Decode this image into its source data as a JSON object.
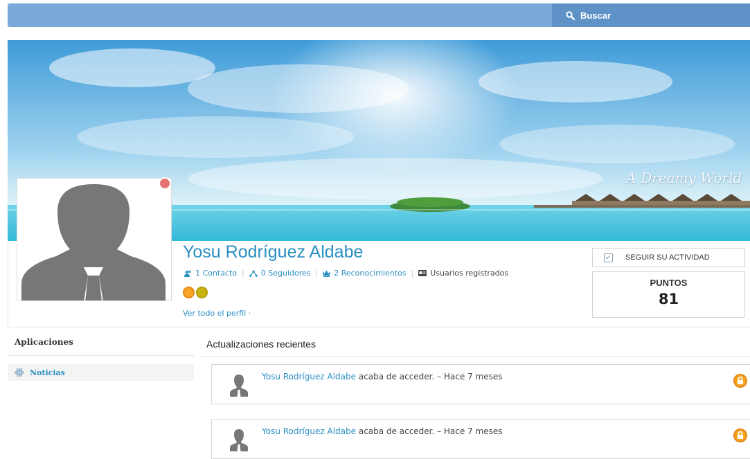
{
  "search": {
    "label": "Buscar"
  },
  "cover": {
    "caption": "A Dreamy World"
  },
  "profile": {
    "name": "Yosu Rodríguez Aldabe",
    "contacts": "1 Contacto",
    "followers": "0 Seguidores",
    "awards": "2 Reconocimientos",
    "group": "Usuarios registrados",
    "view_all": "Ver todo el perfil ·"
  },
  "actions": {
    "follow_label": "SEGUIR SU ACTIVIDAD",
    "points_label": "PUNTOS",
    "points_value": "81"
  },
  "sidebar": {
    "title": "Aplicaciones",
    "items": [
      {
        "label": "Noticias",
        "icon": "atom-icon"
      }
    ]
  },
  "feed": {
    "title": "Actualizaciones recientes",
    "entries": [
      {
        "user": "Yosu Rodríguez Aldabe",
        "action": "acaba de acceder.",
        "time": "– Hace 7 meses"
      },
      {
        "user": "Yosu Rodríguez Aldabe",
        "action": "acaba de acceder.",
        "time": "– Hace 7 meses"
      }
    ]
  },
  "colors": {
    "accent": "#2b8fc2",
    "topbar": "#7aa9d9",
    "search": "#5f93c8",
    "status": "#e57373",
    "badge": "#f5a623"
  }
}
